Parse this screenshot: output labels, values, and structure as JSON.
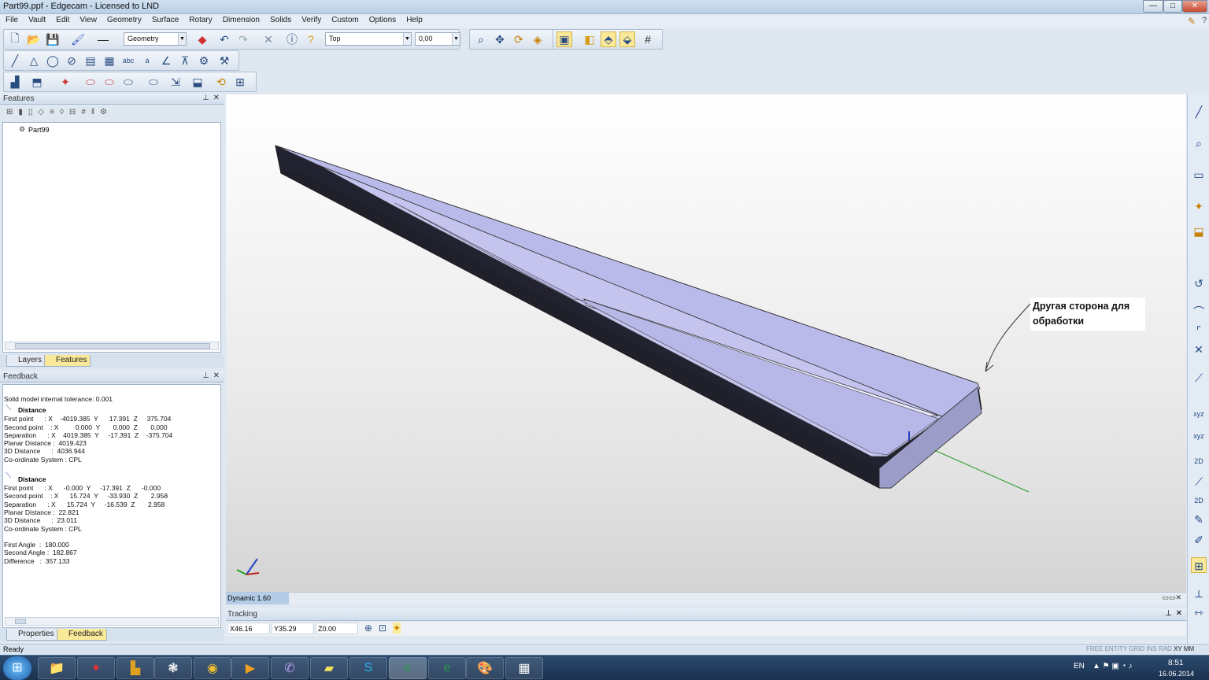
{
  "window": {
    "title": "Part99.ppf - Edgecam - Licensed to LND",
    "minimize": "—",
    "maximize": "□",
    "close": "✕"
  },
  "menu": [
    "File",
    "Vault",
    "Edit",
    "View",
    "Geometry",
    "Surface",
    "Rotary",
    "Dimension",
    "Solids",
    "Verify",
    "Custom",
    "Options",
    "Help"
  ],
  "toolbar": {
    "mode_value": "Geometry",
    "view_value": "Top",
    "depth_value": "0,00"
  },
  "features_panel": {
    "title": "Features",
    "tree_root": "Part99",
    "tabs": [
      "Layers",
      "Features"
    ]
  },
  "feedback_panel": {
    "title": "Feedback",
    "tolerance": "Solid model internal tolerance: 0.001",
    "blocks": [
      {
        "heading": "Distance",
        "lines": [
          "First point      : X    -4019.385  Y      17.391  Z     375.704",
          "Second point    : X         0.000  Y       0.000  Z       0.000",
          "Separation      : X    4019.385  Y     -17.391  Z    -375.704",
          "Planar Distance :  4019.423",
          "3D Distance      :  4036.944",
          "Co-ordinate System : CPL"
        ]
      },
      {
        "heading": "Distance",
        "lines": [
          "First point      : X      -0.000  Y     -17.391  Z      -0.000",
          "Second point    : X      15.724  Y     -33.930  Z       2.958",
          "Separation      : X      15.724  Y     -16.539  Z       2.958",
          "Planar Distance :  22.821",
          "3D Distance      :  23.011",
          "Co-ordinate System : CPL",
          "",
          "First Angle  :  180.000",
          "Second Angle :  182.867",
          "Difference   :  357.133"
        ]
      }
    ],
    "tabs": [
      "Properties",
      "Feedback"
    ]
  },
  "viewport": {
    "annotation_line1": "Другая сторона для",
    "annotation_line2": "обработки",
    "dynamic_label": "Dynamic 1.60"
  },
  "tracking": {
    "title": "Tracking",
    "x": "X46.16",
    "y": "Y35.29",
    "z": "Z0.00"
  },
  "status": {
    "text": "Ready",
    "indicators": [
      "FREE",
      "ENTITY",
      "GRID",
      "INS",
      "RAD",
      "XY",
      "MM"
    ]
  },
  "taskbar": {
    "lang": "EN",
    "time": "8:51",
    "date": "16.06.2014"
  },
  "colors": {
    "part_top": "#b7b7e8",
    "part_side": "#202028",
    "accent": "#fbe99a"
  }
}
